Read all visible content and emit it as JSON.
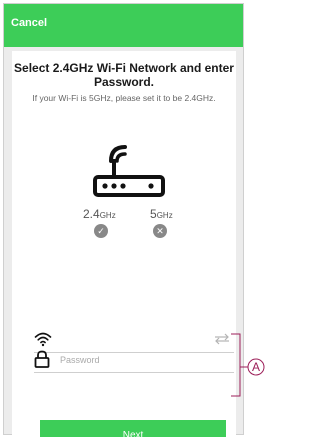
{
  "header": {
    "cancel_label": "Cancel",
    "bg_color": "#3dcd58"
  },
  "content": {
    "title": "Select 2.4GHz Wi-Fi Network and enter Password.",
    "subtitle": "If your Wi-Fi is 5GHz, please set it to be 2.4GHz.",
    "router_icon": "router-icon",
    "bands": [
      {
        "value": "2.4",
        "unit": "GHz",
        "status_icon": "check-icon"
      },
      {
        "value": "5",
        "unit": "GHz",
        "status_icon": "cross-icon"
      }
    ]
  },
  "form": {
    "wifi_icon": "wifi-icon",
    "swap_icon": "swap-icon",
    "lock_icon": "lock-icon",
    "password_placeholder": "Password"
  },
  "actions": {
    "next_label": "Next",
    "button_color": "#3dcd58"
  },
  "annotation": {
    "label": "A",
    "color": "#9c1e58"
  }
}
